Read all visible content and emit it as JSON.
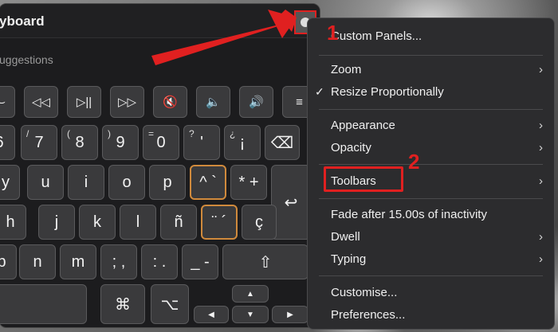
{
  "keyboard": {
    "title": "yboard",
    "suggestions": "uggestions",
    "media_keys": [
      "⌣",
      "◁◁",
      "▷||",
      "▷▷",
      "🔇",
      "🔈",
      "🔊",
      "≡"
    ],
    "row_numbers": [
      {
        "sub": "&",
        "main": "6"
      },
      {
        "sub": "/",
        "main": "7"
      },
      {
        "sub": "(",
        "main": "8"
      },
      {
        "sub": ")",
        "main": "9"
      },
      {
        "sub": "=",
        "main": "0"
      },
      {
        "sub": "?",
        "main": "'"
      },
      {
        "sub": "¿",
        "main": "¡"
      },
      {
        "sub": "",
        "main": "⌫"
      }
    ],
    "row_top": [
      "y",
      "u",
      "i",
      "o",
      "p",
      "^  `",
      "*  +"
    ],
    "row_home": [
      "h",
      "j",
      "k",
      "l",
      "ñ",
      "¨  ´",
      "ç"
    ],
    "row_bottom": [
      "b",
      "n",
      "m",
      ";  ,",
      ":  .",
      "_  -",
      "⇧"
    ],
    "row_mod": [
      "⌘",
      "⌥"
    ],
    "arrows": [
      "▲",
      "◀",
      "▼",
      "▶"
    ],
    "return_key": "↩"
  },
  "menu": {
    "items": [
      {
        "label": "Custom Panels...",
        "submenu": false,
        "checked": false
      },
      {
        "label": "Zoom",
        "submenu": true,
        "checked": false
      },
      {
        "label": "Resize Proportionally",
        "submenu": false,
        "checked": true
      },
      {
        "label": "Appearance",
        "submenu": true,
        "checked": false
      },
      {
        "label": "Opacity",
        "submenu": true,
        "checked": false
      },
      {
        "label": "Toolbars",
        "submenu": true,
        "checked": false
      },
      {
        "label": "Fade after 15.00s of inactivity",
        "submenu": false,
        "checked": false
      },
      {
        "label": "Dwell",
        "submenu": true,
        "checked": false
      },
      {
        "label": "Typing",
        "submenu": true,
        "checked": false
      },
      {
        "label": "Customise...",
        "submenu": false,
        "checked": false
      },
      {
        "label": "Preferences...",
        "submenu": false,
        "checked": false
      }
    ],
    "check_glyph": "✓",
    "chevron_glyph": "›"
  },
  "annotations": {
    "step1": "1",
    "step2": "2",
    "color": "#e02020"
  }
}
